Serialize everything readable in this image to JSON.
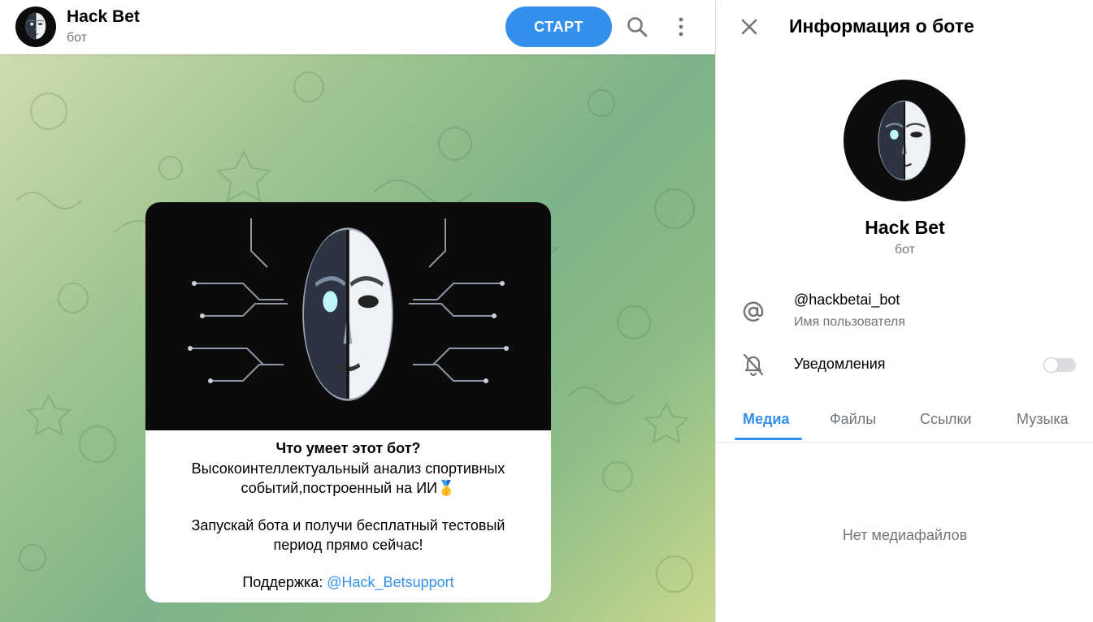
{
  "chat": {
    "title": "Hack Bet",
    "subtitle": "бот",
    "start_label": "СТАРТ",
    "icons": {
      "search": "search-icon",
      "menu": "more-vertical-icon"
    },
    "bubble": {
      "heading": "Что умеет этот бот?",
      "line1": "Высокоинтеллектуальный анализ спортивных",
      "line2": "событий,построенный на ИИ🥇",
      "line3": "Запускай бота и получи бесплатный тестовый",
      "line4": "период прямо сейчас!",
      "support_prefix": "Поддержка: ",
      "support_link": "@Hack_Betsupport"
    }
  },
  "info": {
    "title": "Информация о боте",
    "name": "Hack Bet",
    "type": "бот",
    "username": "@hackbetai_bot",
    "username_label": "Имя пользователя",
    "notifications_label": "Уведомления",
    "notifications_on": false,
    "tabs": [
      {
        "label": "Медиа",
        "active": true
      },
      {
        "label": "Файлы",
        "active": false
      },
      {
        "label": "Ссылки",
        "active": false
      },
      {
        "label": "Музыка",
        "active": false
      }
    ],
    "empty_text": "Нет медиафайлов"
  },
  "colors": {
    "accent": "#3390ec",
    "secondary_text": "#707579"
  }
}
